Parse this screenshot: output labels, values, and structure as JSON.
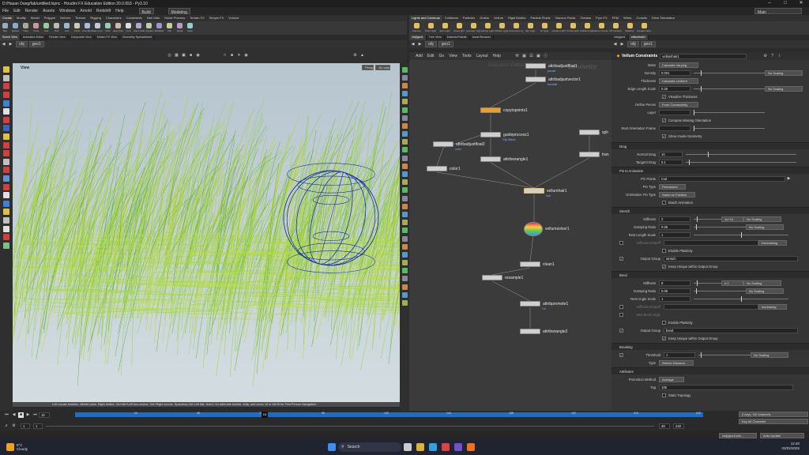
{
  "window": {
    "title": "D:/Hasan Dang/fab/untitled.hipnc - Houdini FX Education Edition 20.0.653 - Py3.10"
  },
  "menu": [
    "File",
    "Edit",
    "Render",
    "Assets",
    "Windows",
    "Arnold",
    "Redshift",
    "Help"
  ],
  "build_label": "Build",
  "desktop_label": "Modeling",
  "main_label": "Main",
  "shelf_tabs_left": [
    "Create",
    "Modify",
    "Model",
    "Polygon",
    "Deform",
    "Texture",
    "Rigging",
    "Characters",
    "Constraints",
    "Hair Utils",
    "Guide Process",
    "Terrain FX",
    "Simple FX",
    "Volume"
  ],
  "shelf_tabs_right": [
    "Lights and Cameras",
    "Collisions",
    "Particles",
    "Grains",
    "Vellum",
    "Rigid Bodies",
    "Particle Fluids",
    "Viscous Fluids",
    "Oceans",
    "Pyro FX",
    "FEM",
    "Wires",
    "Crowds",
    "Drive Simulation"
  ],
  "shelf_tools_left": [
    "Box",
    "Sphere",
    "Tube",
    "Torus",
    "Grid",
    "Null",
    "Line",
    "Circle",
    "Curve Bezier",
    "Draw Curve",
    "Path",
    "Spray Paint",
    "Font",
    "Platonic Solids",
    "L-System",
    "Metaball",
    "File",
    "Spiral",
    "Helix"
  ],
  "shelf_tools_right": [
    "Camera",
    "Point Light",
    "Spot Light",
    "Area Light",
    "Geometry Light",
    "Volume Light",
    "Distant Light",
    "Environment Light",
    "Sky Light",
    "GI Light",
    "Caustic Light",
    "Portal Light",
    "Ambient Light",
    "Stereo Camera",
    "VR Camera",
    "Switcher",
    "Gamepad Camera"
  ],
  "left_panel_tabs": [
    "Scene View",
    "Animation Editor",
    "Render View",
    "Composite View",
    "Motion FX View",
    "Geometry Spreadsheet"
  ],
  "right_panel_tabs": [
    "/obj/geo1",
    "Tree View",
    "Material Palette",
    "Asset Browser"
  ],
  "param_panel_tabs": [
    "/obj/geo1",
    "vellumhair1"
  ],
  "path": {
    "obj": "obj",
    "geo": "geo1"
  },
  "viewport": {
    "label": "View",
    "persp": "Persp",
    "cam": "No cam",
    "status": "Left mouse tumbles. Middle pans. Right dollies. Ctrl+Alt+Left box-zooms. Ctrl+Right zooms. Spacebar-Ctrl-Left tilts. Hold L for alternate tumble, dolly, and zoom. M or Alt+M for First Person Navigation."
  },
  "network": {
    "menus": [
      "Add",
      "Edit",
      "Go",
      "View",
      "Tools",
      "Layout",
      "Help"
    ],
    "watermark_left": "Education Edition",
    "watermark_right": "Geometry",
    "nodes": [
      {
        "label": "attribadjustfloat1",
        "sub": "pscale"
      },
      {
        "label": "attribadjustvector1",
        "sub": "bendatt"
      },
      {
        "label": "copytopoints1",
        "sub": ""
      },
      {
        "label": "guideprocess1",
        "sub": "Clip Blend"
      },
      {
        "label": "attribadjustfloat2",
        "sub": "color"
      },
      {
        "label": "attribwrangle1",
        "sub": ""
      },
      {
        "label": "color1",
        "sub": ""
      },
      {
        "label": "sph",
        "sub": ""
      },
      {
        "label": "tran",
        "sub": ""
      },
      {
        "label": "vellumhair1",
        "sub": "hair"
      },
      {
        "label": "vellumsolver1",
        "sub": ""
      },
      {
        "label": "clean1",
        "sub": ""
      },
      {
        "label": "resample1",
        "sub": ""
      },
      {
        "label": "attribpromote1",
        "sub": "Cd"
      },
      {
        "label": "attribwrangle2",
        "sub": ""
      }
    ]
  },
  "params": {
    "header": "Vellum Constraints",
    "node_name": "vellumhair1",
    "rows": [
      {
        "label": "Mass",
        "type": "button",
        "value": "Calculate Varying",
        "extra": "",
        "scale": ""
      },
      {
        "label": "Density",
        "type": "field",
        "value": "0.001",
        "extra": "",
        "scale": "No Scaling"
      },
      {
        "label": "Thickness",
        "type": "button",
        "value": "Calculate Uniform",
        "extra": "",
        "scale": ""
      },
      {
        "label": "Edge Length Scale",
        "type": "field",
        "value": "0.25",
        "extra": "",
        "scale": "No Scaling"
      },
      {
        "label": "",
        "type": "check",
        "value": "Visualize Thickness",
        "extra": "",
        "scale": ""
      },
      {
        "label": "Define Pieces",
        "type": "button",
        "value": "From Connectivity",
        "extra": "",
        "scale": ""
      },
      {
        "label": "Layer",
        "type": "field",
        "value": "",
        "extra": "",
        "scale": ""
      },
      {
        "label": "",
        "type": "check",
        "value": "Compute Missing Orientation",
        "extra": "",
        "scale": ""
      },
      {
        "label": "Rest Orientation Frame",
        "type": "field",
        "value": "",
        "extra": "",
        "scale": ""
      },
      {
        "label": "",
        "type": "check",
        "value": "Show Guide Geometry",
        "extra": "",
        "scale": ""
      }
    ],
    "drag_title": "Drag",
    "normal_drag": "10",
    "tangent_drag": "0.1",
    "pin_title": "Pin to Animation",
    "pin_points": "root",
    "pin_type": "Permanent",
    "orientation_pin_type": "Same as Position",
    "match_animation": "Match Animation",
    "stretch_title": "Stretch",
    "stretch_stiffness": "2",
    "stretch_exp": "1e+10",
    "stretch_damping": "0.05",
    "rest_length_scale": "1",
    "stiffness_dropoff": "Stiffness Dropoff",
    "decreasing": "Decreasing",
    "enable_plasticity": "Enable Plasticity",
    "output_group": "Output Group",
    "stretch_group": "stretch",
    "keep_unique": "Keep Unique within Output Group",
    "bend_title": "Bend",
    "bend_stiffness": "8",
    "bend_exp": "0.1",
    "bend_damping": "0.05",
    "rest_angle_scale": "1",
    "increasing": "Increasing",
    "max_bend_angle": "Max Bend Angle",
    "bend_group": "bend",
    "breaking_title": "Breaking",
    "threshold": "1",
    "breaking_type": "Stretch Distance",
    "attributes_title": "Attributes",
    "promotion_method": "Average",
    "tag": "105",
    "static_topology": "Static Topology",
    "labels": {
      "normal_drag": "Normal Drag",
      "tangent_drag": "Tangent Drag",
      "pin_points": "Pin Points",
      "pin_type": "Pin Type",
      "orientation_pin_type": "Orientation Pin Type",
      "stiffness": "Stiffness",
      "damping_ratio": "Damping Ratio",
      "rest_length_scale": "Rest Length Scale",
      "rest_angle_scale": "Rest Angle Scale",
      "threshold": "Threshold",
      "type": "Type",
      "promotion_method": "Promotion Method",
      "tag": "Tag",
      "no_scaling": "No Scaling"
    }
  },
  "timeline": {
    "frame": "15",
    "start": "1",
    "start2": "1",
    "end_a": "48",
    "end_b": "240",
    "ticks": [
      "24",
      "48",
      "72",
      "96",
      "120",
      "144",
      "168",
      "192",
      "216",
      "240"
    ],
    "keys": "0 keys, 0/0 channels",
    "all_channels": "Key All Channels",
    "auto_update": "Auto Update",
    "obj_path": "/obj/geo1/vell..."
  },
  "taskbar": {
    "temp": "6°C",
    "weather": "Cloudy",
    "search": "Search",
    "time": "12:40",
    "date": "03/02/2025"
  },
  "colors": {
    "accent": "#ff9f1a",
    "viewport_top": "#b7c5cf",
    "hair_green": "#8fd12a",
    "sphere_blue": "#1b2fb5"
  }
}
